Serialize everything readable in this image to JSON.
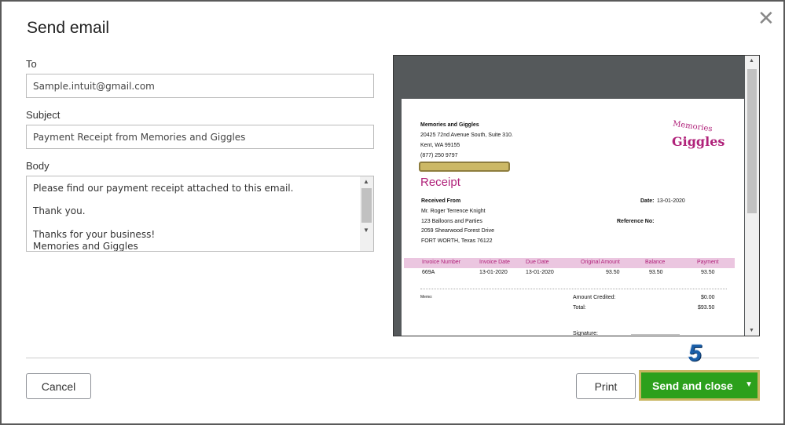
{
  "dialog": {
    "title": "Send email",
    "close_icon": "close-icon"
  },
  "form": {
    "to_label": "To",
    "to_value": "Sample.intuit@gmail.com",
    "subject_label": "Subject",
    "subject_value": "Payment Receipt from Memories and Giggles",
    "body_label": "Body",
    "body_value": "Please find our payment receipt attached to this email.\n\nThank you.\n\nThanks for your business!\nMemories and Giggles"
  },
  "receipt": {
    "company": "Memories and Giggles",
    "address1": "20425 72nd Avenue South, Suite 310.",
    "address2": "Kent, WA  99155",
    "phone": "(877) 250 9797",
    "logo_text": "Memories & Giggles",
    "heading": "Receipt",
    "received_from_label": "Received From",
    "customer": [
      "Mr. Roger Terrence Knight",
      "123 Balloons and Parties",
      "2059  Shearwood Forest Drive",
      "FORT WORTH, Texas  76122"
    ],
    "date_label": "Date:",
    "date": "13-01-2020",
    "reference_label": "Reference No:",
    "columns": [
      "Invoice Number",
      "Invoice Date",
      "Due Date",
      "Original Amount",
      "Balance",
      "Payment"
    ],
    "row": [
      "669A",
      "13-01-2020",
      "13-01-2020",
      "93.50",
      "93.50",
      "93.50"
    ],
    "memo_label": "Memo:",
    "credited_label": "Amount Credited:",
    "credited": "$0.00",
    "total_label": "Total:",
    "total": "$93.50",
    "signature_label": "Signature:"
  },
  "footer": {
    "cancel": "Cancel",
    "print": "Print",
    "send": "Send and close",
    "step_badge": "5"
  },
  "colors": {
    "accent": "#2ca01c",
    "highlight": "#c8b560",
    "receipt": "#b0227a"
  }
}
